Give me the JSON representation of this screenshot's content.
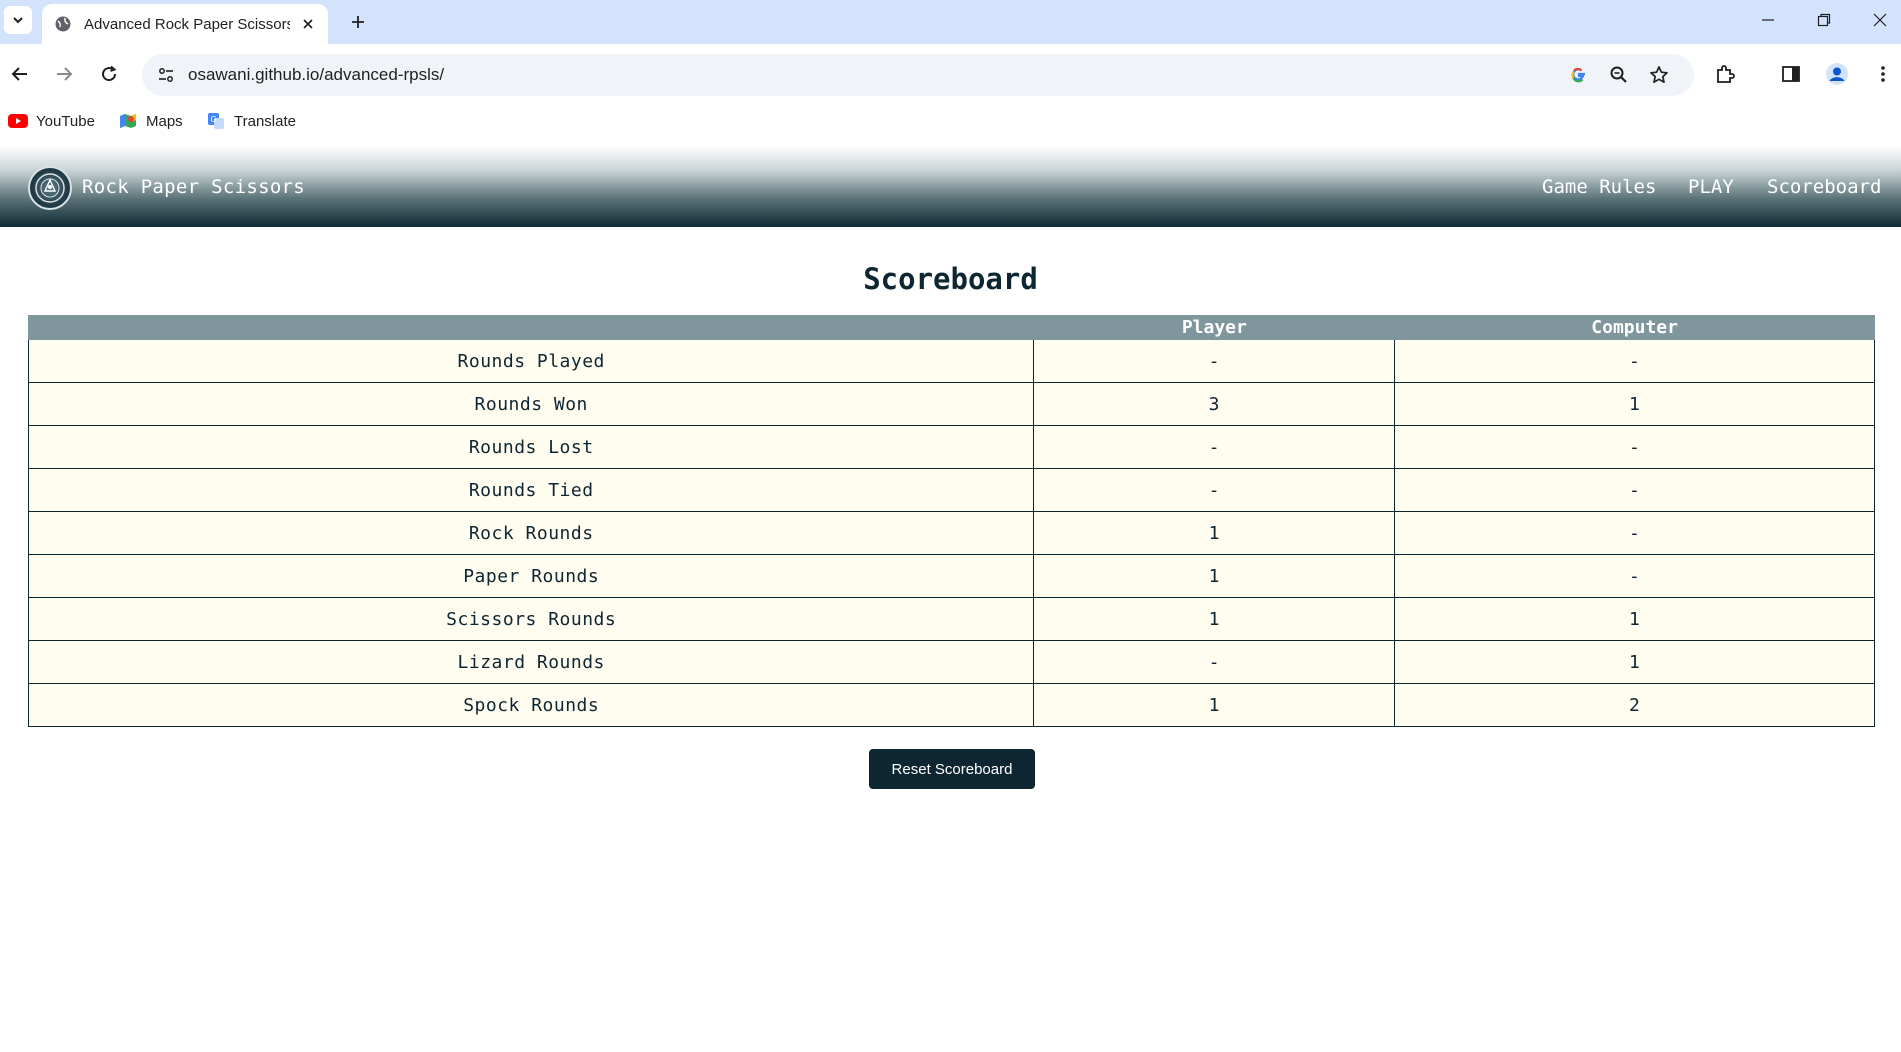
{
  "browser": {
    "tab_title": "Advanced Rock Paper Scissors",
    "url": "osawani.github.io/advanced-rpsls/",
    "bookmarks": [
      {
        "label": "YouTube",
        "icon": "youtube-icon"
      },
      {
        "label": "Maps",
        "icon": "maps-icon"
      },
      {
        "label": "Translate",
        "icon": "translate-icon"
      }
    ]
  },
  "header": {
    "brand": "Rock Paper Scissors",
    "nav": [
      "Game Rules",
      "PLAY",
      "Scoreboard"
    ]
  },
  "main": {
    "title": "Scoreboard",
    "table": {
      "columns": [
        "",
        "Player",
        "Computer"
      ],
      "rows": [
        {
          "label": "Rounds Played",
          "player": "-",
          "computer": "-"
        },
        {
          "label": "Rounds Won",
          "player": "3",
          "computer": "1"
        },
        {
          "label": "Rounds Lost",
          "player": "-",
          "computer": "-"
        },
        {
          "label": "Rounds Tied",
          "player": "-",
          "computer": "-"
        },
        {
          "label": "Rock Rounds",
          "player": "1",
          "computer": "-"
        },
        {
          "label": "Paper Rounds",
          "player": "1",
          "computer": "-"
        },
        {
          "label": "Scissors Rounds",
          "player": "1",
          "computer": "1"
        },
        {
          "label": "Lizard Rounds",
          "player": "-",
          "computer": "1"
        },
        {
          "label": "Spock Rounds",
          "player": "1",
          "computer": "2"
        }
      ]
    },
    "reset_label": "Reset Scoreboard"
  },
  "colors": {
    "header_dark": "#0f2a33",
    "table_header": "#7f969c",
    "table_cell": "#fffcf0",
    "button": "#0e2632"
  }
}
